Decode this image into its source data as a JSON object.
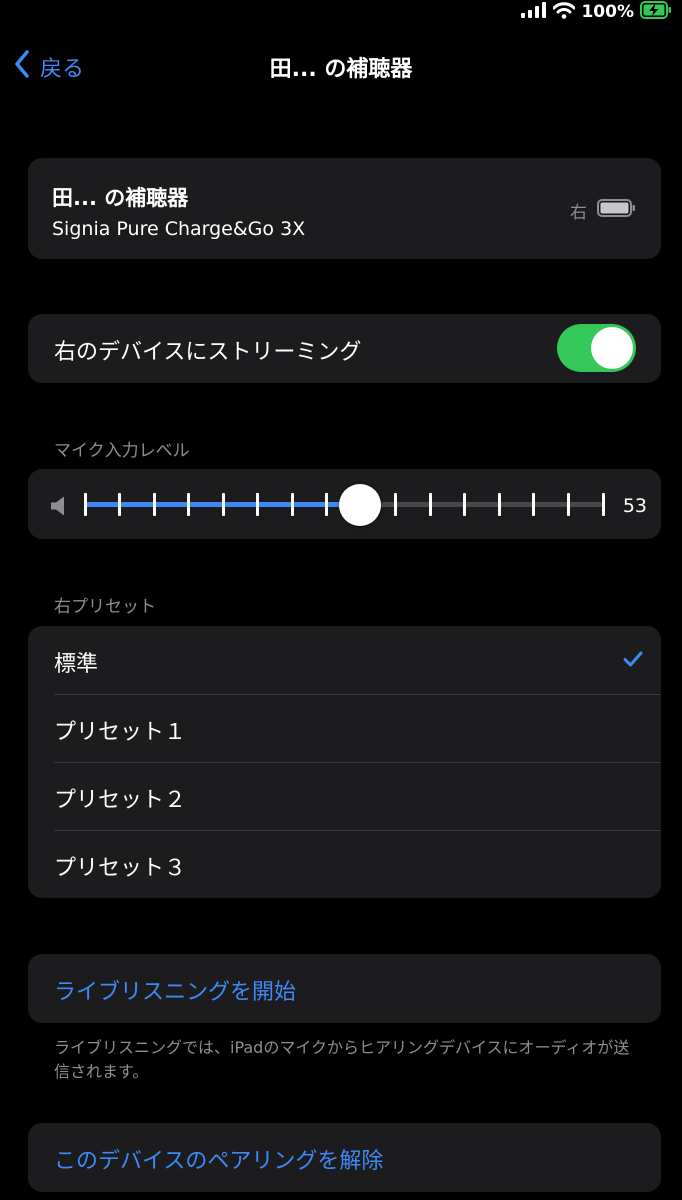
{
  "status_bar": {
    "battery_percent": "100%"
  },
  "nav": {
    "back_label": "戻る",
    "title": "田... の補聴器"
  },
  "device": {
    "name": "田... の補聴器",
    "model": "Signia Pure Charge&Go 3X",
    "side_label": "右"
  },
  "streaming": {
    "label": "右のデバイスにストリーミング",
    "enabled": true
  },
  "mic_level": {
    "header": "マイク入力レベル",
    "value": "53",
    "fraction": 0.53,
    "tick_count": 16
  },
  "presets": {
    "header": "右プリセット",
    "items": [
      {
        "label": "標準",
        "selected": true
      },
      {
        "label": "プリセット１",
        "selected": false
      },
      {
        "label": "プリセット２",
        "selected": false
      },
      {
        "label": "プリセット３",
        "selected": false
      }
    ]
  },
  "live_listen": {
    "label": "ライブリスニングを開始",
    "footnote": "ライブリスニングでは、iPadのマイクからヒアリングデバイスにオーディオが送信されます。"
  },
  "unpair": {
    "label": "このデバイスのペアリングを解除"
  },
  "colors": {
    "accent": "#3d8af7",
    "toggle_on": "#34c759",
    "battery_charging": "#34c759",
    "cell_background": "#1c1c1e",
    "secondary_text": "#8d8d92"
  }
}
